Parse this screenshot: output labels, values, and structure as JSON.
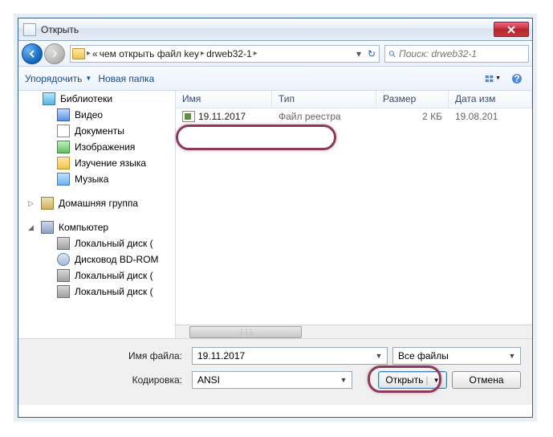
{
  "window": {
    "title": "Открыть"
  },
  "nav": {
    "breadcrumb": {
      "prefix": "«",
      "seg1": "чем открыть файл key",
      "seg2": "drweb32-1"
    },
    "search_placeholder": "Поиск: drweb32-1"
  },
  "toolbar": {
    "organize": "Упорядочить",
    "new_folder": "Новая папка"
  },
  "sidebar": {
    "items": [
      {
        "label": "Библиотеки",
        "icon": "lib"
      },
      {
        "label": "Видео",
        "icon": "vid"
      },
      {
        "label": "Документы",
        "icon": "doc"
      },
      {
        "label": "Изображения",
        "icon": "img"
      },
      {
        "label": "Изучение языка",
        "icon": "folder"
      },
      {
        "label": "Музыка",
        "icon": "mus"
      }
    ],
    "homegroup": "Домашняя группа",
    "computer": "Компьютер",
    "drives": [
      {
        "label": "Локальный диск (",
        "icon": "disk"
      },
      {
        "label": "Дисковод BD-ROM",
        "icon": "bd"
      },
      {
        "label": "Локальный диск (",
        "icon": "disk"
      },
      {
        "label": "Локальный диск (",
        "icon": "disk"
      }
    ]
  },
  "list": {
    "cols": {
      "name": "Имя",
      "type": "Тип",
      "size": "Размер",
      "date": "Дата изм"
    },
    "row": {
      "name": "19.11.2017",
      "type": "Файл реестра",
      "size": "2 КБ",
      "date": "19.08.201"
    }
  },
  "bottom": {
    "filename_label": "Имя файла:",
    "filename_value": "19.11.2017",
    "filter": "Все файлы",
    "encoding_label": "Кодировка:",
    "encoding_value": "ANSI",
    "open": "Открыть",
    "cancel": "Отмена"
  }
}
